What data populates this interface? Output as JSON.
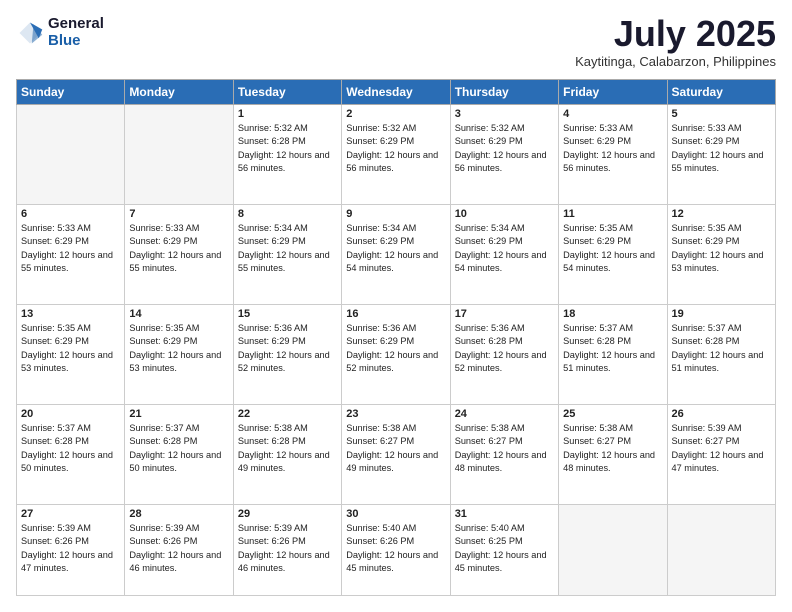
{
  "logo": {
    "general": "General",
    "blue": "Blue"
  },
  "header": {
    "month": "July 2025",
    "location": "Kaytitinga, Calabarzon, Philippines"
  },
  "weekdays": [
    "Sunday",
    "Monday",
    "Tuesday",
    "Wednesday",
    "Thursday",
    "Friday",
    "Saturday"
  ],
  "weeks": [
    [
      {
        "day": "",
        "sunrise": "",
        "sunset": "",
        "daylight": ""
      },
      {
        "day": "",
        "sunrise": "",
        "sunset": "",
        "daylight": ""
      },
      {
        "day": "1",
        "sunrise": "Sunrise: 5:32 AM",
        "sunset": "Sunset: 6:28 PM",
        "daylight": "Daylight: 12 hours and 56 minutes."
      },
      {
        "day": "2",
        "sunrise": "Sunrise: 5:32 AM",
        "sunset": "Sunset: 6:29 PM",
        "daylight": "Daylight: 12 hours and 56 minutes."
      },
      {
        "day": "3",
        "sunrise": "Sunrise: 5:32 AM",
        "sunset": "Sunset: 6:29 PM",
        "daylight": "Daylight: 12 hours and 56 minutes."
      },
      {
        "day": "4",
        "sunrise": "Sunrise: 5:33 AM",
        "sunset": "Sunset: 6:29 PM",
        "daylight": "Daylight: 12 hours and 56 minutes."
      },
      {
        "day": "5",
        "sunrise": "Sunrise: 5:33 AM",
        "sunset": "Sunset: 6:29 PM",
        "daylight": "Daylight: 12 hours and 55 minutes."
      }
    ],
    [
      {
        "day": "6",
        "sunrise": "Sunrise: 5:33 AM",
        "sunset": "Sunset: 6:29 PM",
        "daylight": "Daylight: 12 hours and 55 minutes."
      },
      {
        "day": "7",
        "sunrise": "Sunrise: 5:33 AM",
        "sunset": "Sunset: 6:29 PM",
        "daylight": "Daylight: 12 hours and 55 minutes."
      },
      {
        "day": "8",
        "sunrise": "Sunrise: 5:34 AM",
        "sunset": "Sunset: 6:29 PM",
        "daylight": "Daylight: 12 hours and 55 minutes."
      },
      {
        "day": "9",
        "sunrise": "Sunrise: 5:34 AM",
        "sunset": "Sunset: 6:29 PM",
        "daylight": "Daylight: 12 hours and 54 minutes."
      },
      {
        "day": "10",
        "sunrise": "Sunrise: 5:34 AM",
        "sunset": "Sunset: 6:29 PM",
        "daylight": "Daylight: 12 hours and 54 minutes."
      },
      {
        "day": "11",
        "sunrise": "Sunrise: 5:35 AM",
        "sunset": "Sunset: 6:29 PM",
        "daylight": "Daylight: 12 hours and 54 minutes."
      },
      {
        "day": "12",
        "sunrise": "Sunrise: 5:35 AM",
        "sunset": "Sunset: 6:29 PM",
        "daylight": "Daylight: 12 hours and 53 minutes."
      }
    ],
    [
      {
        "day": "13",
        "sunrise": "Sunrise: 5:35 AM",
        "sunset": "Sunset: 6:29 PM",
        "daylight": "Daylight: 12 hours and 53 minutes."
      },
      {
        "day": "14",
        "sunrise": "Sunrise: 5:35 AM",
        "sunset": "Sunset: 6:29 PM",
        "daylight": "Daylight: 12 hours and 53 minutes."
      },
      {
        "day": "15",
        "sunrise": "Sunrise: 5:36 AM",
        "sunset": "Sunset: 6:29 PM",
        "daylight": "Daylight: 12 hours and 52 minutes."
      },
      {
        "day": "16",
        "sunrise": "Sunrise: 5:36 AM",
        "sunset": "Sunset: 6:29 PM",
        "daylight": "Daylight: 12 hours and 52 minutes."
      },
      {
        "day": "17",
        "sunrise": "Sunrise: 5:36 AM",
        "sunset": "Sunset: 6:28 PM",
        "daylight": "Daylight: 12 hours and 52 minutes."
      },
      {
        "day": "18",
        "sunrise": "Sunrise: 5:37 AM",
        "sunset": "Sunset: 6:28 PM",
        "daylight": "Daylight: 12 hours and 51 minutes."
      },
      {
        "day": "19",
        "sunrise": "Sunrise: 5:37 AM",
        "sunset": "Sunset: 6:28 PM",
        "daylight": "Daylight: 12 hours and 51 minutes."
      }
    ],
    [
      {
        "day": "20",
        "sunrise": "Sunrise: 5:37 AM",
        "sunset": "Sunset: 6:28 PM",
        "daylight": "Daylight: 12 hours and 50 minutes."
      },
      {
        "day": "21",
        "sunrise": "Sunrise: 5:37 AM",
        "sunset": "Sunset: 6:28 PM",
        "daylight": "Daylight: 12 hours and 50 minutes."
      },
      {
        "day": "22",
        "sunrise": "Sunrise: 5:38 AM",
        "sunset": "Sunset: 6:28 PM",
        "daylight": "Daylight: 12 hours and 49 minutes."
      },
      {
        "day": "23",
        "sunrise": "Sunrise: 5:38 AM",
        "sunset": "Sunset: 6:27 PM",
        "daylight": "Daylight: 12 hours and 49 minutes."
      },
      {
        "day": "24",
        "sunrise": "Sunrise: 5:38 AM",
        "sunset": "Sunset: 6:27 PM",
        "daylight": "Daylight: 12 hours and 48 minutes."
      },
      {
        "day": "25",
        "sunrise": "Sunrise: 5:38 AM",
        "sunset": "Sunset: 6:27 PM",
        "daylight": "Daylight: 12 hours and 48 minutes."
      },
      {
        "day": "26",
        "sunrise": "Sunrise: 5:39 AM",
        "sunset": "Sunset: 6:27 PM",
        "daylight": "Daylight: 12 hours and 47 minutes."
      }
    ],
    [
      {
        "day": "27",
        "sunrise": "Sunrise: 5:39 AM",
        "sunset": "Sunset: 6:26 PM",
        "daylight": "Daylight: 12 hours and 47 minutes."
      },
      {
        "day": "28",
        "sunrise": "Sunrise: 5:39 AM",
        "sunset": "Sunset: 6:26 PM",
        "daylight": "Daylight: 12 hours and 46 minutes."
      },
      {
        "day": "29",
        "sunrise": "Sunrise: 5:39 AM",
        "sunset": "Sunset: 6:26 PM",
        "daylight": "Daylight: 12 hours and 46 minutes."
      },
      {
        "day": "30",
        "sunrise": "Sunrise: 5:40 AM",
        "sunset": "Sunset: 6:26 PM",
        "daylight": "Daylight: 12 hours and 45 minutes."
      },
      {
        "day": "31",
        "sunrise": "Sunrise: 5:40 AM",
        "sunset": "Sunset: 6:25 PM",
        "daylight": "Daylight: 12 hours and 45 minutes."
      },
      {
        "day": "",
        "sunrise": "",
        "sunset": "",
        "daylight": ""
      },
      {
        "day": "",
        "sunrise": "",
        "sunset": "",
        "daylight": ""
      }
    ]
  ]
}
